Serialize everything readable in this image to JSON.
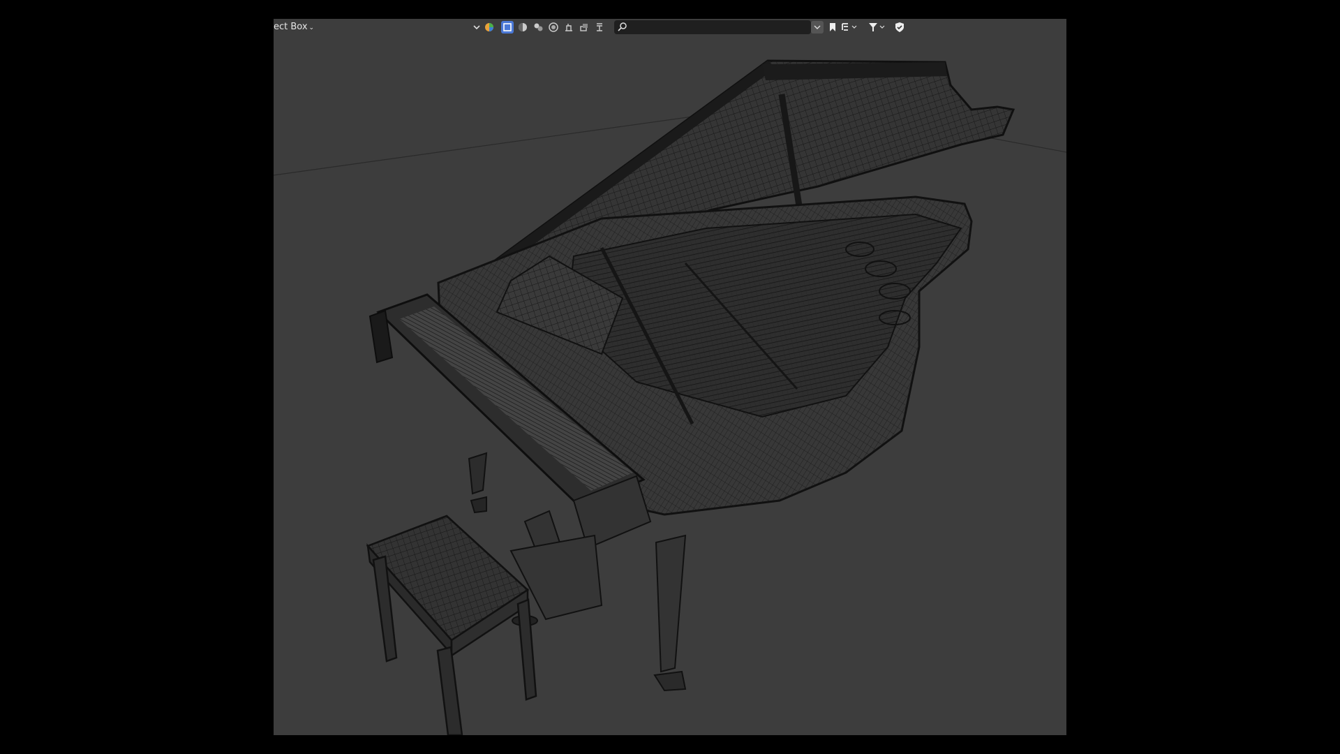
{
  "header": {
    "select_mode_label": "ect Box",
    "search": {
      "placeholder": "",
      "value": ""
    }
  },
  "icons": {
    "select_mode_dropdown": "chevron-down-icon",
    "mode_dropdown": "chevron-down-icon",
    "tools": [
      "render-engine-icon",
      "select-box-icon",
      "viewport-shading-solid-icon",
      "material-preview-icon",
      "rendered-shading-icon",
      "tool-icon-a",
      "tool-icon-b",
      "tool-icon-c"
    ],
    "search": "search-icon",
    "right_tools": [
      "collapse-icon",
      "bookmark-icon",
      "layout-icon",
      "filter-icon",
      "shield-check-icon"
    ]
  },
  "colors": {
    "viewport_bg": "#3d3d3d",
    "wireframe": "#111111",
    "accent_select": "#4a78d6"
  },
  "scene": {
    "object": "grand-piano-wireframe",
    "extra_object": "piano-bench-wireframe"
  }
}
